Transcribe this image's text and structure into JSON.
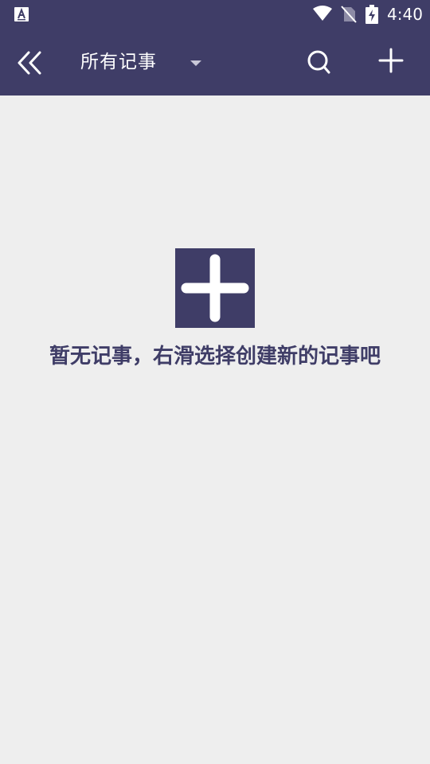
{
  "status_bar": {
    "time": "4:40",
    "app_icon": "a-letter-icon",
    "wifi_icon": "wifi-icon",
    "sim_icon": "no-sim-icon",
    "battery_icon": "battery-charging-icon"
  },
  "toolbar": {
    "back_icon": "double-chevron-left-icon",
    "title": "所有记事",
    "dropdown_icon": "caret-down-icon",
    "search_icon": "search-icon",
    "add_icon": "plus-icon"
  },
  "empty_state": {
    "add_icon": "plus-icon",
    "message": "暂无记事，右滑选择创建新的记事吧"
  },
  "colors": {
    "primary": "#3f3d67",
    "background": "#eeeeee",
    "on_primary": "#ffffff"
  }
}
